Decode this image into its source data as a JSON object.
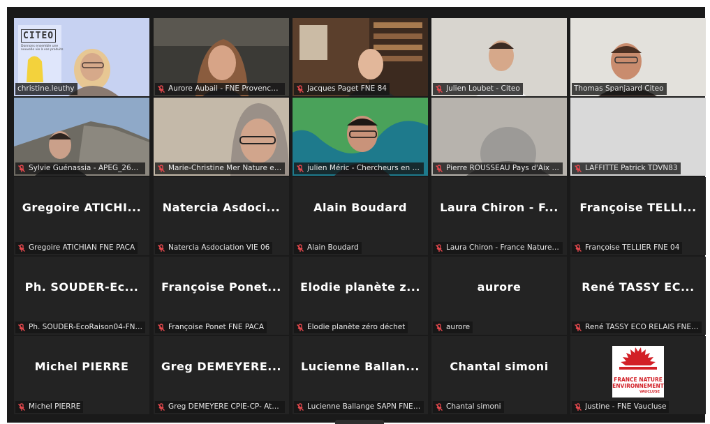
{
  "app": "zoom-gallery",
  "tiles": [
    {
      "id": "t1",
      "display_name": "christine.leuthy",
      "muted": false,
      "has_video": true,
      "speaking": true
    },
    {
      "id": "t2",
      "display_name": "Aurore Aubail - FNE Provence-...",
      "muted": true,
      "has_video": true
    },
    {
      "id": "t3",
      "display_name": "Jacques Paget FNE 84",
      "muted": true,
      "has_video": true
    },
    {
      "id": "t4",
      "display_name": "Julien Loubet - Citeo",
      "muted": true,
      "has_video": true
    },
    {
      "id": "t5",
      "display_name": "Thomas Spanjaard Citeo",
      "muted": false,
      "has_video": true
    },
    {
      "id": "t6",
      "display_name": "Sylvie Guénassia - APEG_2623...",
      "muted": true,
      "has_video": true
    },
    {
      "id": "t7",
      "display_name": "Marie-Christine Mer Nature et ...",
      "muted": true,
      "has_video": true
    },
    {
      "id": "t8",
      "display_name": "julien Méric - Chercheurs en he...",
      "muted": true,
      "has_video": true
    },
    {
      "id": "t9",
      "display_name": "Pierre ROUSSEAU Pays d'Aix Ec...",
      "muted": true,
      "has_video": true
    },
    {
      "id": "t10",
      "display_name": "LAFFITTE Patrick TDVN83",
      "muted": true,
      "has_video": true
    },
    {
      "id": "t11",
      "display_name": "Gregoire ATICHIAN FNE PACA",
      "center_name": "Gregoire ATICHI...",
      "muted": true
    },
    {
      "id": "t12",
      "display_name": "Natercia Asdociation VIE 06",
      "center_name": "Natercia Asdoci...",
      "muted": true
    },
    {
      "id": "t13",
      "display_name": "Alain Boudard",
      "center_name": "Alain Boudard",
      "muted": true
    },
    {
      "id": "t14",
      "display_name": "Laura Chiron - France Nature E...",
      "center_name": "Laura Chiron - F...",
      "muted": true
    },
    {
      "id": "t15",
      "display_name": "Françoise TELLIER FNE 04",
      "center_name": "Françoise TELLI...",
      "muted": true
    },
    {
      "id": "t16",
      "display_name": "Ph. SOUDER-EcoRaison04-FNE...",
      "center_name": "Ph. SOUDER-Ec...",
      "muted": true
    },
    {
      "id": "t17",
      "display_name": "Françoise Ponet FNE PACA",
      "center_name": "Françoise Ponet...",
      "muted": true
    },
    {
      "id": "t18",
      "display_name": "Elodie planète zéro déchet",
      "center_name": "Elodie planète z...",
      "muted": true
    },
    {
      "id": "t19",
      "display_name": "aurore",
      "center_name": "aurore",
      "muted": true
    },
    {
      "id": "t20",
      "display_name": "René TASSY ECO RELAIS FNE P...",
      "center_name": "René TASSY EC...",
      "muted": true
    },
    {
      "id": "t21",
      "display_name": "Michel PIERRE",
      "center_name": "Michel PIERRE",
      "muted": true
    },
    {
      "id": "t22",
      "display_name": "Greg DEMEYERE CPIE-CP- Ateli...",
      "center_name": "Greg DEMEYERE...",
      "muted": true
    },
    {
      "id": "t23",
      "display_name": "Lucienne Ballange SAPN FNE05",
      "center_name": "Lucienne Ballan...",
      "muted": true
    },
    {
      "id": "t24",
      "display_name": "Chantal simoni",
      "center_name": "Chantal simoni",
      "muted": true
    },
    {
      "id": "t25",
      "display_name": "Justine - FNE Vaucluse",
      "muted": true,
      "has_logo": true
    }
  ],
  "citeo_logo": {
    "word": "CITEO",
    "tagline_1": "Donnons ensemble une",
    "tagline_2": "nouvelle vie à vos produits"
  },
  "fne_logo": {
    "line1": "FRANCE NATURE",
    "line2": "ENVIRONNEMENT",
    "line3": "VAUCLUSE"
  },
  "colors": {
    "speaking_border": "#c6e84b",
    "mic_muted": "#e5484d",
    "tile_bg": "#232323",
    "fne_red": "#d21f26"
  }
}
